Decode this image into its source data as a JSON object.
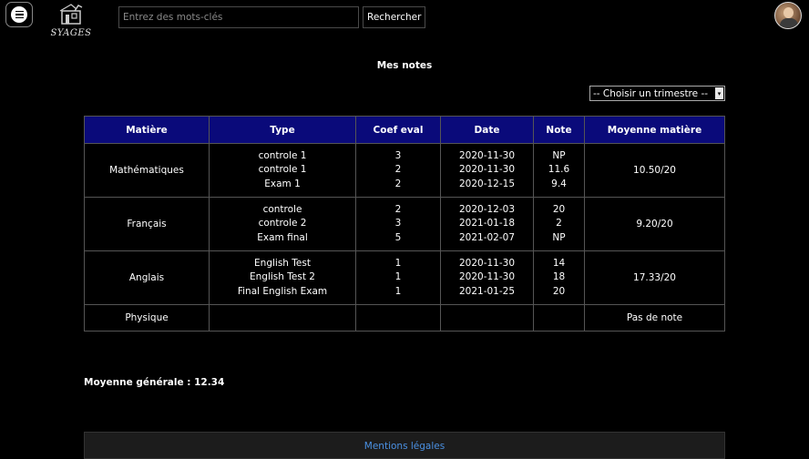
{
  "header": {
    "logo_text": "SYAGES",
    "search_placeholder": "Entrez des mots-clés",
    "search_button": "Rechercher"
  },
  "page": {
    "title": "Mes notes",
    "trimester_select": "-- Choisir un trimestre --"
  },
  "table": {
    "headers": [
      "Matière",
      "Type",
      "Coef eval",
      "Date",
      "Note",
      "Moyenne matière"
    ],
    "rows": [
      {
        "subject": "Mathématiques",
        "types": [
          "controle 1",
          "controle 1",
          "Exam 1"
        ],
        "coefs": [
          "3",
          "2",
          "2"
        ],
        "dates": [
          "2020-11-30",
          "2020-11-30",
          "2020-12-15"
        ],
        "notes": [
          "NP",
          "11.6",
          "9.4"
        ],
        "average": "10.50/20"
      },
      {
        "subject": "Français",
        "types": [
          "controle",
          "controle 2",
          "Exam final"
        ],
        "coefs": [
          "2",
          "3",
          "5"
        ],
        "dates": [
          "2020-12-03",
          "2021-01-18",
          "2021-02-07"
        ],
        "notes": [
          "20",
          "2",
          "NP"
        ],
        "average": "9.20/20"
      },
      {
        "subject": "Anglais",
        "types": [
          "English Test",
          "English Test 2",
          "Final English Exam"
        ],
        "coefs": [
          "1",
          "1",
          "1"
        ],
        "dates": [
          "2020-11-30",
          "2020-11-30",
          "2021-01-25"
        ],
        "notes": [
          "14",
          "18",
          "20"
        ],
        "average": "17.33/20"
      },
      {
        "subject": "Physique",
        "types": [],
        "coefs": [],
        "dates": [],
        "notes": [],
        "average": "Pas de note"
      }
    ]
  },
  "general_average": "Moyenne générale : 12.34",
  "footer": {
    "legal_link": "Mentions légales"
  },
  "colors": {
    "header_bg": "#0a0a7a",
    "link": "#4a90e2",
    "background": "#000000"
  },
  "icons": {
    "menu": "hamburger-circle-icon",
    "logo": "syages-logo",
    "avatar": "user-avatar"
  }
}
